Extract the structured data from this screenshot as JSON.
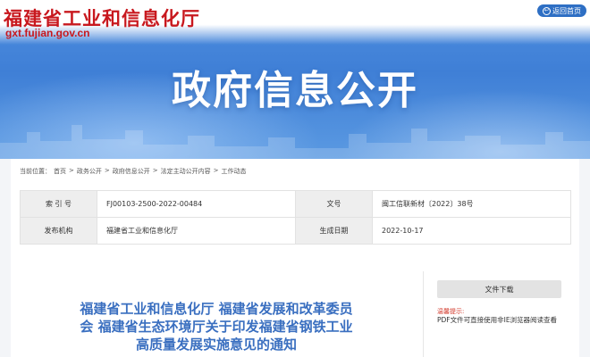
{
  "header": {
    "logo_title": "福建省工业和信息化厅",
    "logo_url": "gxt.fujian.gov.cn",
    "back_label": "返回首页",
    "hero_title": "政府信息公开"
  },
  "breadcrumb": {
    "prefix": "当前位置：",
    "items": [
      "首页",
      "政务公开",
      "政府信息公开",
      "法定主动公开内容",
      "工作动态"
    ],
    "separator": ">"
  },
  "meta": {
    "index_label": "索 引 号",
    "index_value": "FJ00103-2500-2022-00484",
    "doc_no_label": "文号",
    "doc_no_value": "闽工信联新材〔2022〕38号",
    "issuer_label": "发布机构",
    "issuer_value": "福建省工业和信息化厅",
    "date_label": "生成日期",
    "date_value": "2022-10-17"
  },
  "article": {
    "title": "福建省工业和信息化厅 福建省发展和改革委员会 福建省生态环境厅关于印发福建省钢铁工业高质量发展实施意见的通知"
  },
  "sidebar": {
    "download_label": "文件下载",
    "tip_label": "温馨提示:",
    "tip_text": "PDF文件可直接使用非IE浏览器阅读查看"
  },
  "icons": {
    "back": "return-circle-icon"
  },
  "colors": {
    "logo_red": "#c8181e",
    "hero_blue": "#4f8fe0",
    "title_blue": "#3a6fc0",
    "tip_red": "#d33a2c"
  }
}
